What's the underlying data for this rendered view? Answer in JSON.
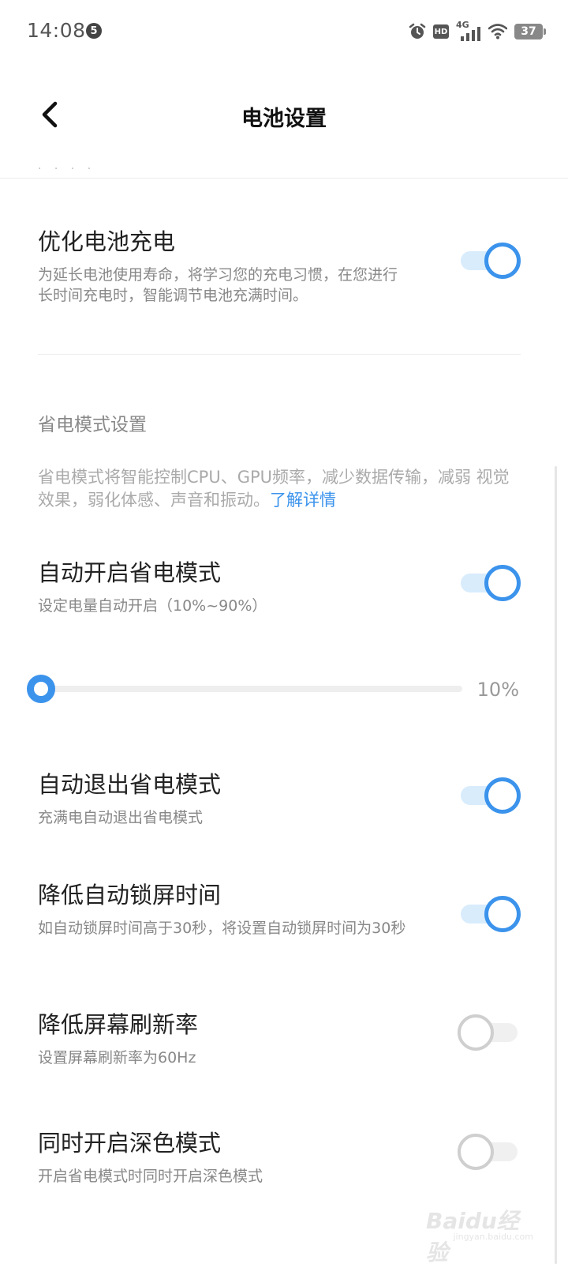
{
  "status_bar": {
    "time": "14:08",
    "notification_count": "5",
    "hd_label": "HD",
    "network_label": "4G",
    "battery_level": "37"
  },
  "header": {
    "title": "电池设置",
    "clipped_text": "· · · ·"
  },
  "optimize_charging": {
    "title": "优化电池充电",
    "description": "为延长电池使用寿命，将学习您的充电习惯，在您进行长时间充电时，智能调节电池充满时间。",
    "enabled": true
  },
  "power_saving_section": {
    "title": "省电模式设置",
    "description": "省电模式将智能控制CPU、GPU频率，减少数据传输，减弱 视觉效果，弱化体感、声音和振动。",
    "link_label": "了解详情"
  },
  "auto_enable": {
    "title": "自动开启省电模式",
    "subtitle": "设定电量自动开启（10%~90%）",
    "enabled": true
  },
  "threshold_slider": {
    "value_label": "10%",
    "fraction": 0.0
  },
  "auto_exit": {
    "title": "自动退出省电模式",
    "subtitle": "充满电自动退出省电模式",
    "enabled": true
  },
  "reduce_lock_time": {
    "title": "降低自动锁屏时间",
    "subtitle": "如自动锁屏时间高于30秒，将设置自动锁屏时间为30秒",
    "enabled": true
  },
  "reduce_refresh_rate": {
    "title": "降低屏幕刷新率",
    "subtitle": "设置屏幕刷新率为60Hz",
    "enabled": false
  },
  "dark_mode": {
    "title": "同时开启深色模式",
    "subtitle": "开启省电模式时同时开启深色模式",
    "enabled": false
  },
  "watermark": {
    "text": "Baidu经验",
    "url": "jingyan.baidu.com"
  },
  "colors": {
    "accent": "#3b93ec",
    "toggle_on_track": "#d8ecfc",
    "toggle_off_track": "#f0f0f0"
  }
}
